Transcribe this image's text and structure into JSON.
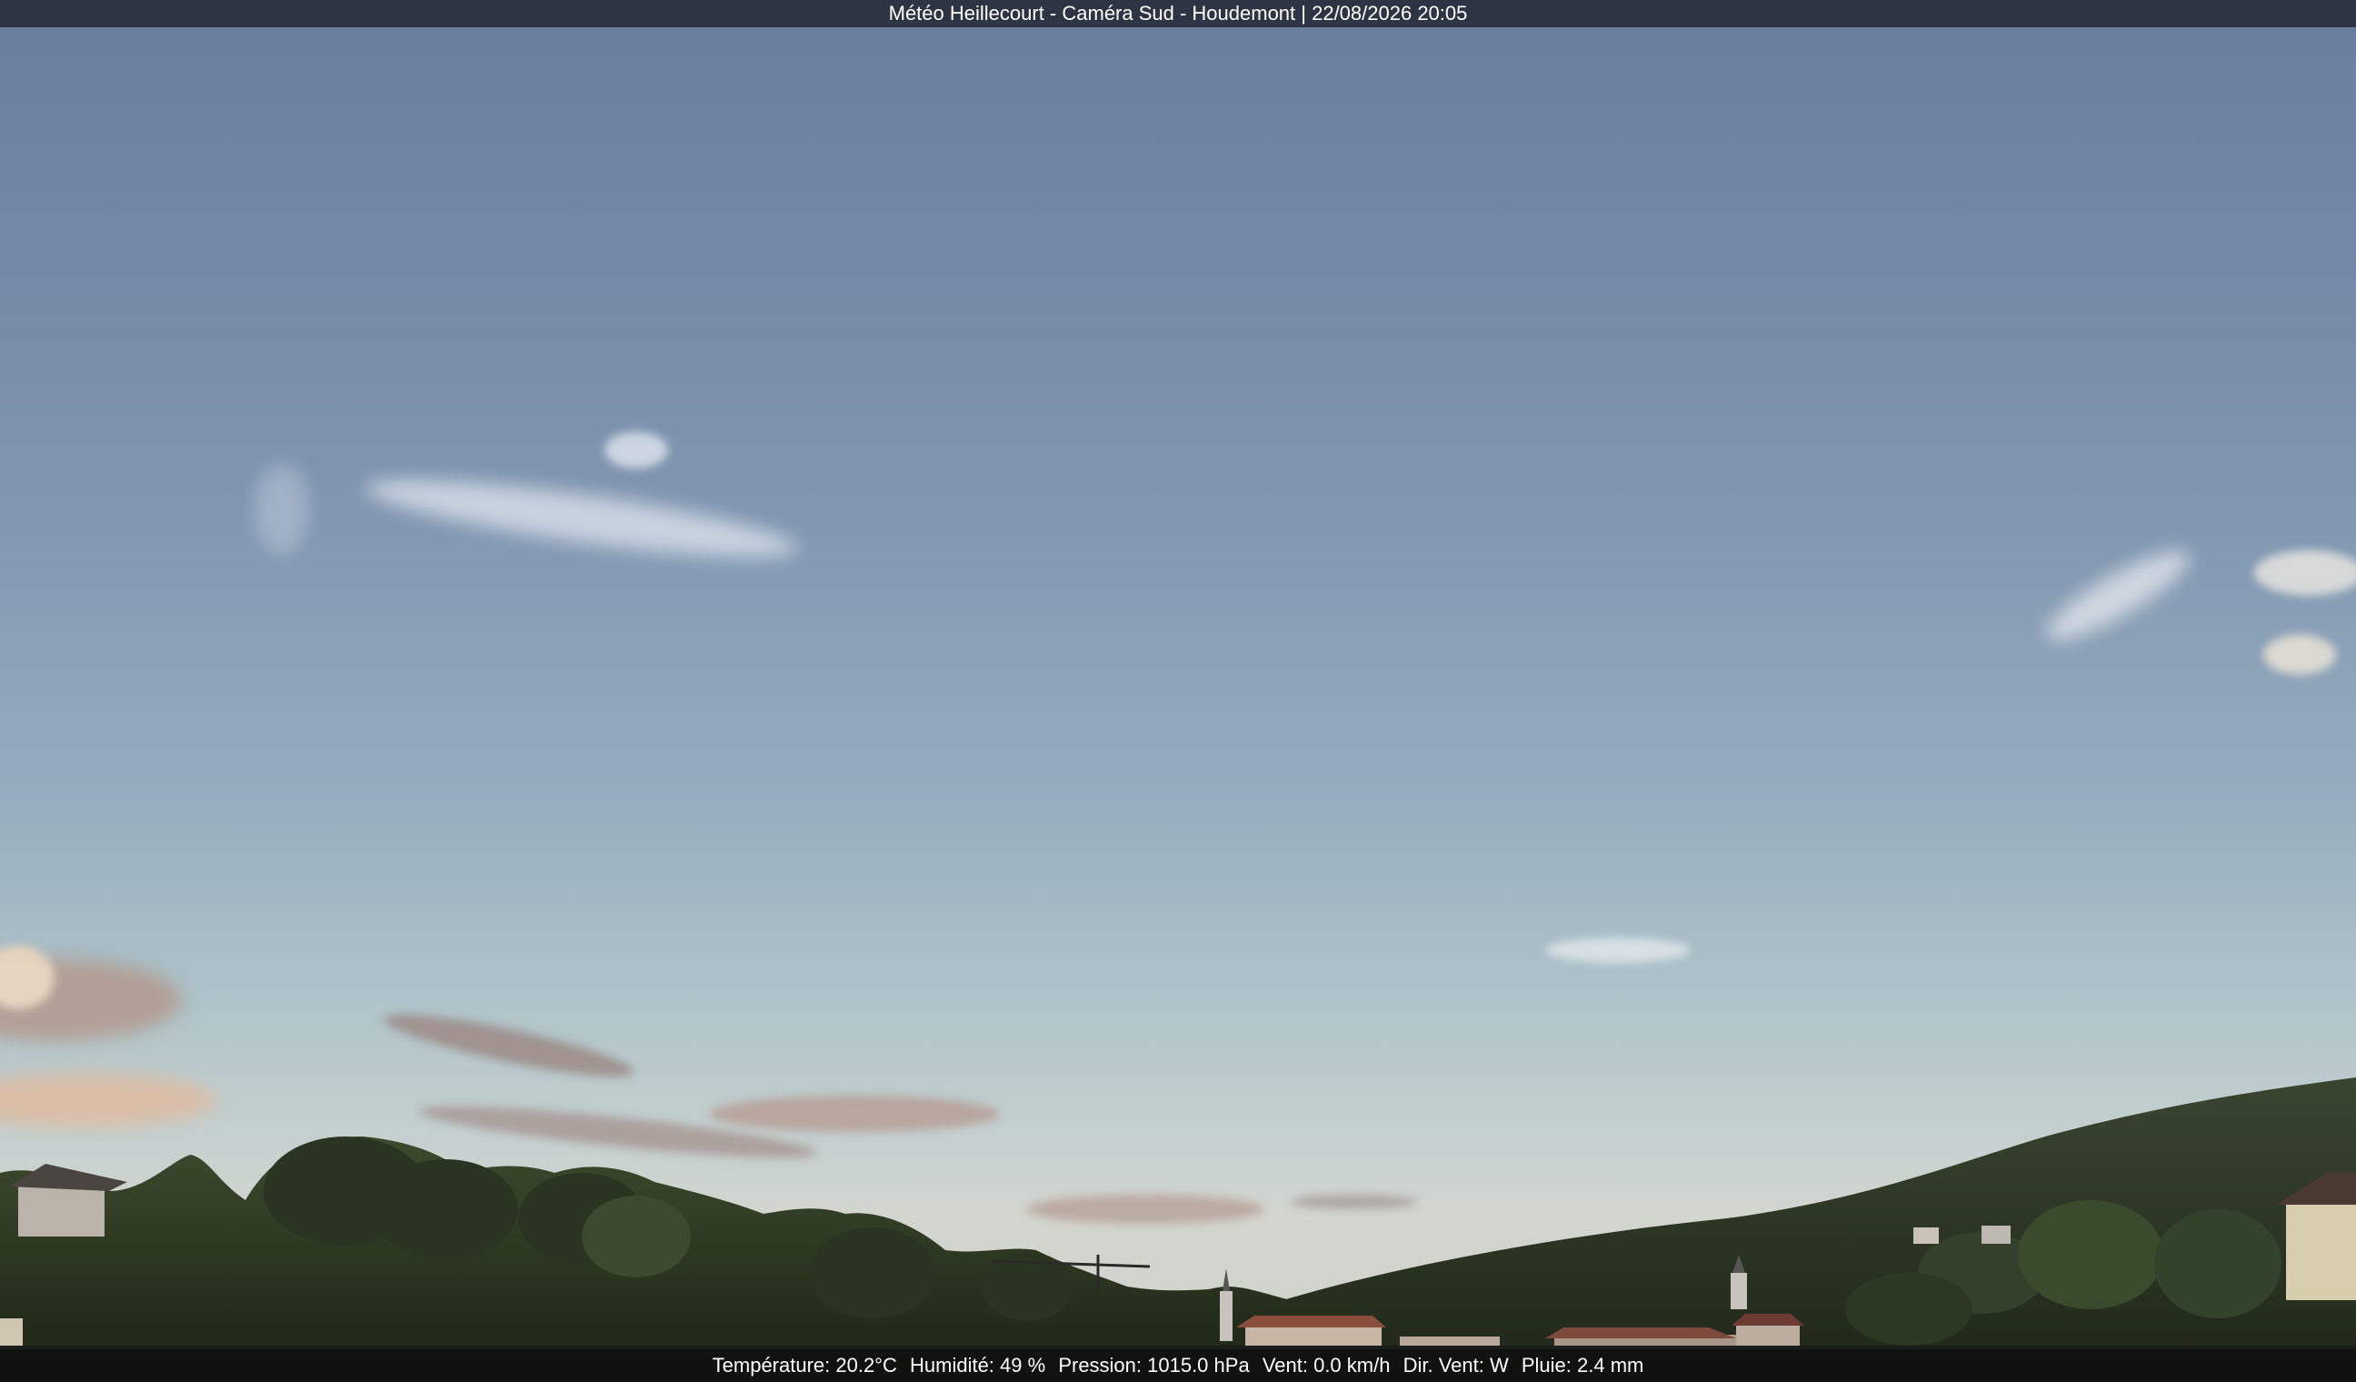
{
  "overlay": {
    "title": "Météo Heillecourt - Caméra Sud - Houdemont | 22/08/2026 20:05",
    "weather": {
      "temperature": "Température: 20.2°C",
      "humidity": "Humidité: 49 %",
      "pressure": "Pression: 1015.0 hPa",
      "wind": "Vent: 0.0 km/h",
      "wind_dir": "Dir. Vent: W",
      "rain": "Pluie: 2.4 mm"
    }
  },
  "colors": {
    "sky_top": "#6b7d9e",
    "sky_horizon": "#d3d6cf",
    "trees": "#2f3a24",
    "title_bar": "#2e3444"
  }
}
